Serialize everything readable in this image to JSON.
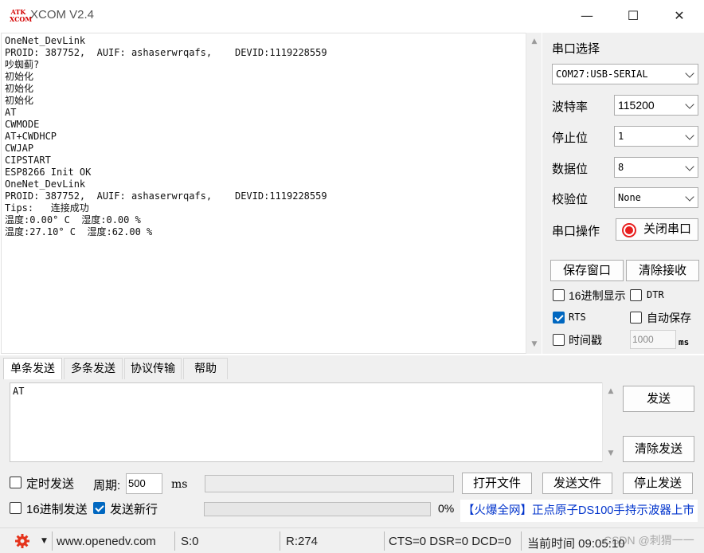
{
  "window": {
    "logo_text": "ATK XCOM",
    "title": "XCOM V2.4",
    "minimize": "—",
    "maximize": "☐",
    "close": "✕"
  },
  "receive": {
    "lines": [
      "OneNet_DevLink",
      "PROID: 387752,  AUIF: ashaserwrqafs,    DEVID:1119228559",
      "吵蜘蓟?",
      "初始化",
      "初始化",
      "初始化",
      "AT",
      "CWMODE",
      "AT+CWDHCP",
      "CWJAP",
      "CIPSTART",
      "ESP8266 Init OK",
      "OneNet_DevLink",
      "PROID: 387752,  AUIF: ashaserwrqafs,    DEVID:1119228559",
      "Tips:   连接成功",
      "温度:0.00° C  湿度:0.00 %",
      "温度:27.10° C  湿度:62.00 %"
    ]
  },
  "serial": {
    "port_label": "串口选择",
    "port_value": "COM27:USB-SERIAL",
    "baud_label": "波特率",
    "baud_value": "115200",
    "stop_label": "停止位",
    "stop_value": "1",
    "data_label": "数据位",
    "data_value": "8",
    "parity_label": "校验位",
    "parity_value": "None",
    "op_label": "串口操作",
    "close_port": "关闭串口"
  },
  "buttons": {
    "save_window": "保存窗口",
    "clear_receive": "清除接收",
    "send": "发送",
    "clear_send": "清除发送",
    "open_file": "打开文件",
    "send_file": "发送文件",
    "stop_send": "停止发送"
  },
  "options": {
    "hex_display": "16进制显示",
    "dtr": "DTR",
    "rts": "RTS",
    "auto_save": "自动保存",
    "timestamp": "时间戳",
    "timestamp_value": "1000",
    "ms": "ms"
  },
  "tabs": [
    "单条发送",
    "多条发送",
    "协议传输",
    "帮助"
  ],
  "send": {
    "text": "AT",
    "timed_send": "定时发送",
    "period_label": "周期:",
    "period_value": "500",
    "period_unit": "ms",
    "hex_send": "16进制发送",
    "send_newline": "发送新行",
    "percent": "0%",
    "ad_text": "【火爆全网】正点原子DS100手持示波器上市"
  },
  "status": {
    "url": "www.openedv.com",
    "s": "S:0",
    "r": "R:274",
    "lines": "CTS=0 DSR=0 DCD=0",
    "time": "当前时间 09:05:10",
    "watermark": "CSDN @刺猬一一"
  },
  "colors": {
    "accent_blue": "#0067c0",
    "record_red": "#e81e1e",
    "ad_blue": "#0033cc",
    "logo_red": "#d40000"
  }
}
